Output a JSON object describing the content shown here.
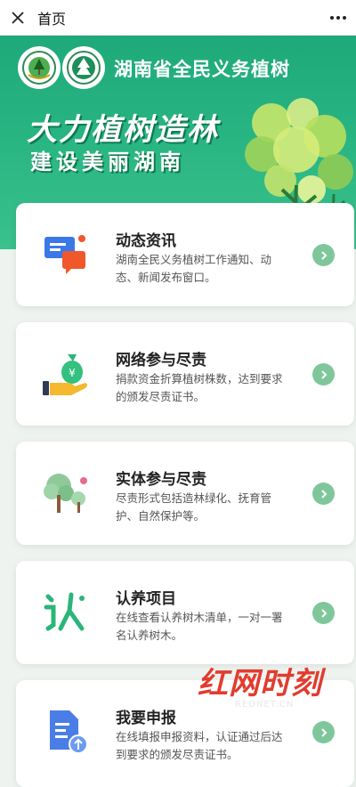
{
  "topbar": {
    "title": "首页"
  },
  "hero": {
    "org_title": "湖南省全民义务植树",
    "slogan_line1": "大力植树造林",
    "slogan_line2": "建设美丽湖南"
  },
  "cards": [
    {
      "title": "动态资讯",
      "desc": "湖南全民义务植树工作通知、动态、新闻发布窗口。",
      "icon": "chat-bubbles-icon"
    },
    {
      "title": "网络参与尽责",
      "desc": "捐款资金折算植树株数，达到要求的颁发尽责证书。",
      "icon": "money-bag-hand-icon"
    },
    {
      "title": "实体参与尽责",
      "desc": "尽责形式包括造林绿化、抚育管护、自然保护等。",
      "icon": "trees-icon"
    },
    {
      "title": "认养项目",
      "desc": "在线查看认养树木清单，一对一署名认养树木。",
      "icon": "adopt-character-icon"
    },
    {
      "title": "我要申报",
      "desc": "在线填报申报资料，认证通过后达到要求的颁发尽责证书。",
      "icon": "document-upload-icon"
    }
  ],
  "watermark": {
    "text": "红网时刻",
    "sub": "REDNET.CN"
  },
  "colors": {
    "primary_green": "#1fa97a",
    "arrow_green": "#7fc79a",
    "watermark_red": "#e23b2e"
  }
}
